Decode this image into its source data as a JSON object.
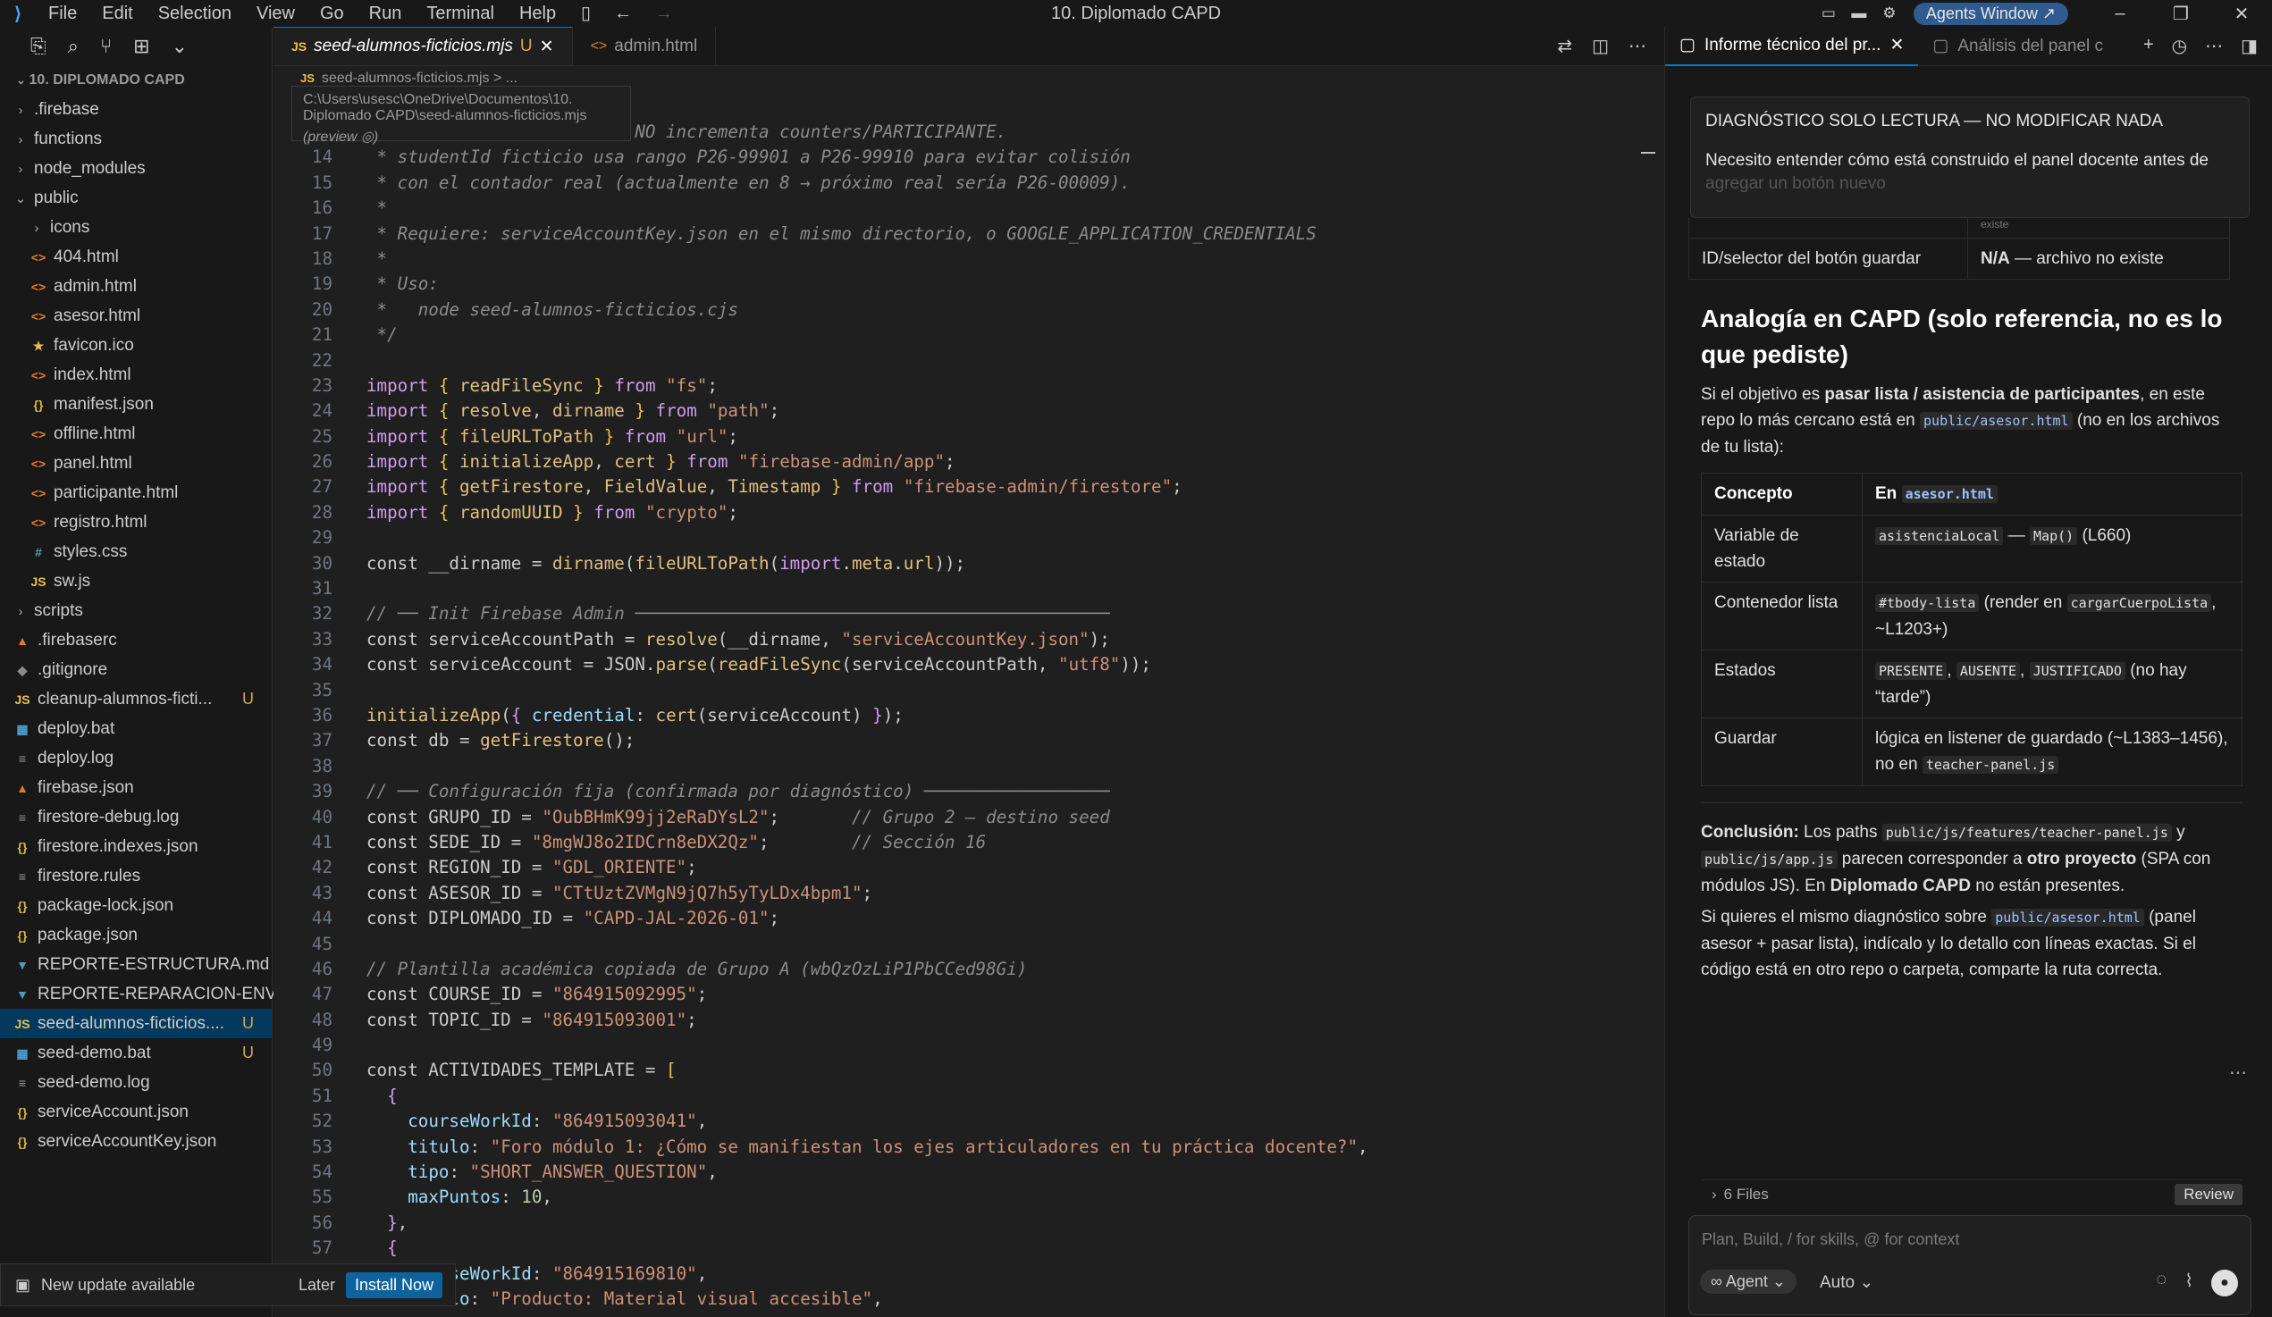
{
  "titlebar": {
    "menu": [
      "File",
      "Edit",
      "Selection",
      "View",
      "Go",
      "Run",
      "Terminal",
      "Help"
    ],
    "window_title": "10. Diplomado CAPD",
    "agents_button": "Agents Window ↗"
  },
  "sidebar": {
    "header": "10. DIPLOMADO CAPD",
    "items": [
      {
        "label": ".firebase",
        "indent": 0,
        "chev": "›",
        "icon": "",
        "badge": ""
      },
      {
        "label": "functions",
        "indent": 0,
        "chev": "›",
        "icon": "",
        "badge": ""
      },
      {
        "label": "node_modules",
        "indent": 0,
        "chev": "›",
        "icon": "",
        "badge": ""
      },
      {
        "label": "public",
        "indent": 0,
        "chev": "⌄",
        "icon": "",
        "badge": ""
      },
      {
        "label": "icons",
        "indent": 1,
        "chev": "›",
        "icon": "",
        "badge": ""
      },
      {
        "label": "404.html",
        "indent": 1,
        "chev": "",
        "icon": "<>",
        "badge": ""
      },
      {
        "label": "admin.html",
        "indent": 1,
        "chev": "",
        "icon": "<>",
        "badge": ""
      },
      {
        "label": "asesor.html",
        "indent": 1,
        "chev": "",
        "icon": "<>",
        "badge": ""
      },
      {
        "label": "favicon.ico",
        "indent": 1,
        "chev": "",
        "icon": "★",
        "badge": ""
      },
      {
        "label": "index.html",
        "indent": 1,
        "chev": "",
        "icon": "<>",
        "badge": ""
      },
      {
        "label": "manifest.json",
        "indent": 1,
        "chev": "",
        "icon": "{}",
        "badge": ""
      },
      {
        "label": "offline.html",
        "indent": 1,
        "chev": "",
        "icon": "<>",
        "badge": ""
      },
      {
        "label": "panel.html",
        "indent": 1,
        "chev": "",
        "icon": "<>",
        "badge": ""
      },
      {
        "label": "participante.html",
        "indent": 1,
        "chev": "",
        "icon": "<>",
        "badge": ""
      },
      {
        "label": "registro.html",
        "indent": 1,
        "chev": "",
        "icon": "<>",
        "badge": ""
      },
      {
        "label": "styles.css",
        "indent": 1,
        "chev": "",
        "icon": "#",
        "badge": ""
      },
      {
        "label": "sw.js",
        "indent": 1,
        "chev": "",
        "icon": "JS",
        "badge": ""
      },
      {
        "label": "scripts",
        "indent": 0,
        "chev": "›",
        "icon": "",
        "badge": ""
      },
      {
        "label": ".firebaserc",
        "indent": 0,
        "chev": "",
        "icon": "▲",
        "badge": ""
      },
      {
        "label": ".gitignore",
        "indent": 0,
        "chev": "",
        "icon": "◆",
        "badge": ""
      },
      {
        "label": "cleanup-alumnos-ficti...",
        "indent": 0,
        "chev": "",
        "icon": "JS",
        "badge": "U"
      },
      {
        "label": "deploy.bat",
        "indent": 0,
        "chev": "",
        "icon": "▦",
        "badge": ""
      },
      {
        "label": "deploy.log",
        "indent": 0,
        "chev": "",
        "icon": "≡",
        "badge": ""
      },
      {
        "label": "firebase.json",
        "indent": 0,
        "chev": "",
        "icon": "▲",
        "badge": ""
      },
      {
        "label": "firestore-debug.log",
        "indent": 0,
        "chev": "",
        "icon": "≡",
        "badge": ""
      },
      {
        "label": "firestore.indexes.json",
        "indent": 0,
        "chev": "",
        "icon": "{}",
        "badge": ""
      },
      {
        "label": "firestore.rules",
        "indent": 0,
        "chev": "",
        "icon": "≡",
        "badge": ""
      },
      {
        "label": "package-lock.json",
        "indent": 0,
        "chev": "",
        "icon": "{}",
        "badge": ""
      },
      {
        "label": "package.json",
        "indent": 0,
        "chev": "",
        "icon": "{}",
        "badge": ""
      },
      {
        "label": "REPORTE-ESTRUCTURA.md",
        "indent": 0,
        "chev": "",
        "icon": "▼",
        "badge": ""
      },
      {
        "label": "REPORTE-REPARACION-ENVI...",
        "indent": 0,
        "chev": "",
        "icon": "▼",
        "badge": ""
      },
      {
        "label": "seed-alumnos-ficticios....",
        "indent": 0,
        "chev": "",
        "icon": "JS",
        "badge": "U",
        "selected": true
      },
      {
        "label": "seed-demo.bat",
        "indent": 0,
        "chev": "",
        "icon": "▦",
        "badge": "U"
      },
      {
        "label": "seed-demo.log",
        "indent": 0,
        "chev": "",
        "icon": "≡",
        "badge": ""
      },
      {
        "label": "serviceAccount.json",
        "indent": 0,
        "chev": "",
        "icon": "{}",
        "badge": ""
      },
      {
        "label": "serviceAccountKey.json",
        "indent": 0,
        "chev": "",
        "icon": "{}",
        "badge": ""
      }
    ],
    "update": {
      "text": "New update available",
      "later": "Later",
      "install": "Install Now"
    }
  },
  "editor": {
    "tabs": [
      {
        "label": "seed-alumnos-ficticios.mjs",
        "status": "U",
        "active": true
      },
      {
        "label": "admin.html",
        "status": "",
        "active": false
      }
    ],
    "breadcrumb": "seed-alumnos-ficticios.mjs > ...",
    "hover_path": "C:\\Users\\usesc\\OneDrive\\Documentos\\10. Diplomado CAPD\\seed-alumnos-ficticios.mjs",
    "hover_preview": "(preview ◎)",
    "lines": [
      {
        "n": "13",
        "html": "<span class='c'> * No toca Firebase Auth. NO incrementa counters/PARTICIPANTE.</span>"
      },
      {
        "n": "14",
        "html": "<span class='c'> * studentId ficticio usa rango P26-99901 a P26-99910 para evitar colisión</span>"
      },
      {
        "n": "15",
        "html": "<span class='c'> * con el contador real (actualmente en 8 → próximo real sería P26-00009).</span>"
      },
      {
        "n": "16",
        "html": "<span class='c'> *</span>"
      },
      {
        "n": "17",
        "html": "<span class='c'> * Requiere: serviceAccountKey.json en el mismo directorio, o GOOGLE_APPLICATION_CREDENTIALS</span>"
      },
      {
        "n": "18",
        "html": "<span class='c'> *</span>"
      },
      {
        "n": "19",
        "html": "<span class='c'> * Uso:</span>"
      },
      {
        "n": "20",
        "html": "<span class='c'> *   node seed-alumnos-ficticios.cjs</span>"
      },
      {
        "n": "21",
        "html": "<span class='c'> */</span>"
      },
      {
        "n": "22",
        "html": ""
      },
      {
        "n": "23",
        "html": "<span class='p'>import</span> <span class='brk'>{</span> <span class='f'>readFileSync</span> <span class='brk'>}</span> <span class='p'>from</span> <span class='s'>\"fs\"</span>;"
      },
      {
        "n": "24",
        "html": "<span class='p'>import</span> <span class='brk'>{</span> <span class='f'>resolve</span>, <span class='f'>dirname</span> <span class='brk'>}</span> <span class='p'>from</span> <span class='s'>\"path\"</span>;"
      },
      {
        "n": "25",
        "html": "<span class='p'>import</span> <span class='brk'>{</span> <span class='f'>fileURLToPath</span> <span class='brk'>}</span> <span class='p'>from</span> <span class='s'>\"url\"</span>;"
      },
      {
        "n": "26",
        "html": "<span class='p'>import</span> <span class='brk'>{</span> <span class='f'>initializeApp</span>, <span class='f'>cert</span> <span class='brk'>}</span> <span class='p'>from</span> <span class='s'>\"firebase-admin/app\"</span>;"
      },
      {
        "n": "27",
        "html": "<span class='p'>import</span> <span class='brk'>{</span> <span class='f'>getFirestore</span>, <span class='f'>FieldValue</span>, <span class='f'>Timestamp</span> <span class='brk'>}</span> <span class='p'>from</span> <span class='s'>\"firebase-admin/firestore\"</span>;"
      },
      {
        "n": "28",
        "html": "<span class='p'>import</span> <span class='brk'>{</span> <span class='f'>randomUUID</span> <span class='brk'>}</span> <span class='p'>from</span> <span class='s'>\"crypto\"</span>;"
      },
      {
        "n": "29",
        "html": ""
      },
      {
        "n": "30",
        "html": "<span class='v'>const __dirname</span> = <span class='f'>dirname</span>(<span class='f'>fileURLToPath</span>(<span class='p'>import</span>.<span class='f'>meta</span>.<span class='f'>url</span>));"
      },
      {
        "n": "31",
        "html": ""
      },
      {
        "n": "32",
        "html": "<span class='c'>// ── Init Firebase Admin ──────────────────────────────────────────────</span>"
      },
      {
        "n": "33",
        "html": "<span class='v'>const serviceAccountPath</span> = <span class='f'>resolve</span>(__dirname, <span class='s'>\"serviceAccountKey.json\"</span>);"
      },
      {
        "n": "34",
        "html": "<span class='v'>const serviceAccount</span> = JSON.<span class='f'>parse</span>(<span class='f'>readFileSync</span>(serviceAccountPath, <span class='s'>\"utf8\"</span>));"
      },
      {
        "n": "35",
        "html": ""
      },
      {
        "n": "36",
        "html": "<span class='f'>initializeApp</span>(<span class='p'>{</span> <span class='pr'>credential</span>: <span class='f'>cert</span>(serviceAccount) <span class='p'>}</span>);"
      },
      {
        "n": "37",
        "html": "<span class='v'>const db</span> = <span class='f'>getFirestore</span>();"
      },
      {
        "n": "38",
        "html": ""
      },
      {
        "n": "39",
        "html": "<span class='c'>// ── Configuración fija (confirmada por diagnóstico) ──────────────────</span>"
      },
      {
        "n": "40",
        "html": "<span class='v'>const GRUPO_ID</span> = <span class='s'>\"OubBHmK99jj2eRaDYsL2\"</span>;       <span class='c'>// Grupo 2 — destino seed</span>"
      },
      {
        "n": "41",
        "html": "<span class='v'>const SEDE_ID</span> = <span class='s'>\"8mgWJ8o2IDCrn8eDX2Qz\"</span>;        <span class='c'>// Sección 16</span>"
      },
      {
        "n": "42",
        "html": "<span class='v'>const REGION_ID</span> = <span class='s'>\"GDL_ORIENTE\"</span>;"
      },
      {
        "n": "43",
        "html": "<span class='v'>const ASESOR_ID</span> = <span class='s'>\"CTtUztZVMgN9jQ7h5yTyLDx4bpm1\"</span>;"
      },
      {
        "n": "44",
        "html": "<span class='v'>const DIPLOMADO_ID</span> = <span class='s'>\"CAPD-JAL-2026-01\"</span>;"
      },
      {
        "n": "45",
        "html": ""
      },
      {
        "n": "46",
        "html": "<span class='c'>// Plantilla académica copiada de Grupo A (wbQzOzLiP1PbCCed98Gi)</span>"
      },
      {
        "n": "47",
        "html": "<span class='v'>const COURSE_ID</span> = <span class='s'>\"864915092995\"</span>;"
      },
      {
        "n": "48",
        "html": "<span class='v'>const TOPIC_ID</span> = <span class='s'>\"864915093001\"</span>;"
      },
      {
        "n": "49",
        "html": ""
      },
      {
        "n": "50",
        "html": "<span class='v'>const ACTIVIDADES_TEMPLATE</span> = <span class='brk'>[</span>"
      },
      {
        "n": "51",
        "html": "  <span class='p'>{</span>"
      },
      {
        "n": "52",
        "html": "    <span class='pr'>courseWorkId</span>: <span class='s'>\"864915093041\"</span>,"
      },
      {
        "n": "53",
        "html": "    <span class='pr'>titulo</span>: <span class='s'>\"Foro módulo 1: ¿Cómo se manifiestan los ejes articuladores en tu práctica docente?\"</span>,"
      },
      {
        "n": "54",
        "html": "    <span class='pr'>tipo</span>: <span class='s'>\"SHORT_ANSWER_QUESTION\"</span>,"
      },
      {
        "n": "55",
        "html": "    <span class='pr'>maxPuntos</span>: <span class='num'>10</span>,"
      },
      {
        "n": "56",
        "html": "  <span class='p'>}</span>,"
      },
      {
        "n": "57",
        "html": "  <span class='p'>{</span>"
      },
      {
        "n": "58",
        "html": "    <span class='pr'>courseWorkId</span>: <span class='s'>\"864915169810\"</span>,"
      },
      {
        "n": "59",
        "html": "    <span class='pr'>titulo</span>: <span class='s'>\"Producto: Material visual accesible\"</span>,"
      }
    ]
  },
  "chat": {
    "tabs": [
      {
        "label": "Informe técnico del pr...",
        "active": true
      },
      {
        "label": "Análisis del panel c",
        "active": false
      }
    ],
    "prompt_lines": [
      "DIAGNÓSTICO SOLO LECTURA — NO MODIFICAR NADA",
      "Necesito entender cómo está construido el panel docente antes de",
      "agregar un botón nuevo"
    ],
    "top_row": {
      "label": "ID/selector del botón guardar",
      "value_bold": "N/A",
      "value_rest": " — archivo no existe"
    },
    "top_partial": "existe",
    "heading": "Analogía en CAPD (solo referencia, no es lo que pediste)",
    "intro_a": "Si el objetivo es ",
    "intro_b": "pasar lista / asistencia de participantes",
    "intro_c": ", en este repo lo más cercano está en ",
    "intro_code": "public/asesor.html",
    "intro_d": " (no en los archivos de tu lista):",
    "table_header": {
      "c1": "Concepto",
      "c2a": "En ",
      "c2code": "asesor.html"
    },
    "rows": [
      {
        "c1": "Variable de estado",
        "code": "asistenciaLocal",
        "mid": " — ",
        "code2": "Map()",
        "rest": " (L660)"
      },
      {
        "c1": "Contenedor lista",
        "code": "#tbody-lista",
        "mid": " (render en ",
        "code2": "cargarCuerpoLista",
        "rest": ", ~L1203+)"
      },
      {
        "c1": "Estados",
        "code": "PRESENTE",
        "mid": ", ",
        "code2": "AUSENTE",
        "mid2": ", ",
        "code3": "JUSTIFICADO",
        "rest": " (no hay “tarde”)"
      },
      {
        "c1": "Guardar",
        "pre": "lógica en listener de guardado (~L1383–1456), no en ",
        "code": "teacher-panel.js"
      }
    ],
    "conclusion_label": "Conclusión:",
    "conclusion_a": " Los paths ",
    "conclusion_code1": "public/js/features/teacher-panel.js",
    "conclusion_b": " y ",
    "conclusion_code2": "public/js/app.js",
    "conclusion_c": " parecen corresponder a ",
    "conclusion_bold1": "otro proyecto",
    "conclusion_d": " (SPA con módulos JS). En ",
    "conclusion_bold2": "Diplomado CAPD",
    "conclusion_e": " no están presentes.",
    "followup_a": "Si quieres el mismo diagnóstico sobre ",
    "followup_code": "public/asesor.html",
    "followup_b": " (panel asesor + pasar lista), indícalo y lo detallo con líneas exactas. Si el código está en otro repo o carpeta, comparte la ruta correcta.",
    "files": "6 Files",
    "review": "Review",
    "input_placeholder": "Plan, Build, / for skills, @ for context",
    "agent_label": "∞ Agent ⌄",
    "auto_label": "Auto ⌄"
  }
}
